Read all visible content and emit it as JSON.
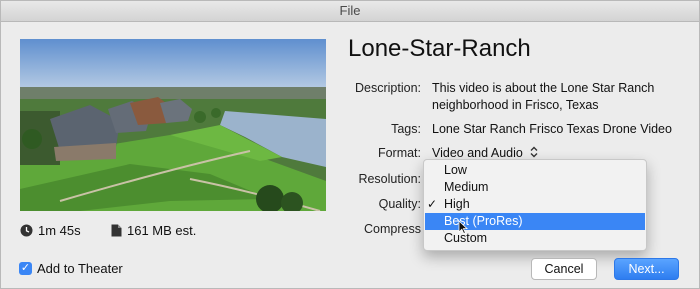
{
  "window": {
    "title": "File"
  },
  "video": {
    "duration": "1m 45s",
    "size": "161 MB est.",
    "title": "Lone-Star-Ranch"
  },
  "fields": {
    "description_label": "Description:",
    "description_value": "This video is about the Lone Star Ranch neighborhood in Frisco, Texas",
    "tags_label": "Tags:",
    "tags_value": "Lone Star Ranch Frisco Texas Drone Video",
    "format_label": "Format:",
    "format_value": "Video and Audio",
    "resolution_label": "Resolution:",
    "quality_label": "Quality:",
    "compression_label": "Compress"
  },
  "quality_menu": {
    "items": [
      {
        "label": "Low",
        "checked": false,
        "highlighted": false
      },
      {
        "label": "Medium",
        "checked": false,
        "highlighted": false
      },
      {
        "label": "High",
        "checked": true,
        "highlighted": false
      },
      {
        "label": "Best (ProRes)",
        "checked": false,
        "highlighted": true
      },
      {
        "label": "Custom",
        "checked": false,
        "highlighted": false
      }
    ],
    "check_glyph": "✓"
  },
  "footer": {
    "add_to_theater_label": "Add to Theater",
    "add_to_theater_checked": true,
    "cancel_label": "Cancel",
    "next_label": "Next..."
  },
  "colors": {
    "accent": "#3a86f5",
    "window_bg": "#ececec"
  },
  "icons": {
    "duration": "clock-icon",
    "size": "file-icon",
    "format_stepper": "updown-chevron-icon",
    "cursor": "arrow-cursor-icon"
  }
}
